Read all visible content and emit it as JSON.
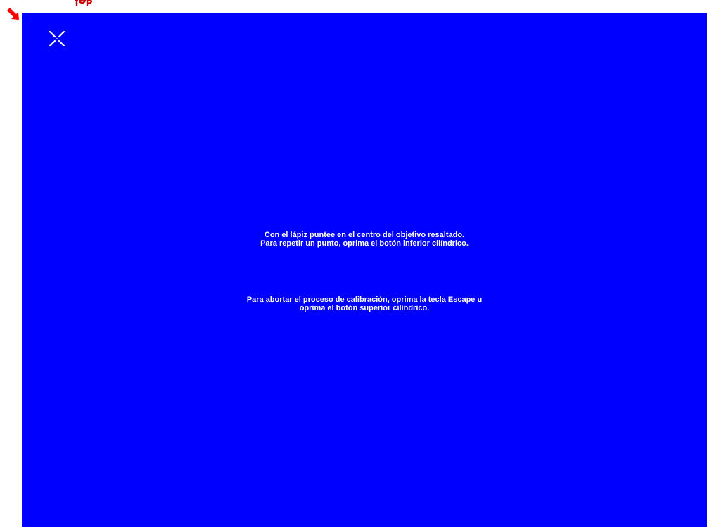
{
  "colors": {
    "screen_background": "#0000ff",
    "text": "#ffffff",
    "pointer": "#ff0000"
  },
  "icons": {
    "pointer": "red-diagonal-arrow-icon",
    "target": "calibration-crosshair-target-icon"
  },
  "instructions": {
    "line1": "Con el lápiz puntee en el centro del objetivo resaltado.",
    "line2": "Para repetir un punto, oprima el botón inferior cilíndrico."
  },
  "abort_info": {
    "line1": "Para abortar el proceso de calibración, oprima la tecla Escape u",
    "line2": "oprima el botón superior cilíndrico."
  }
}
